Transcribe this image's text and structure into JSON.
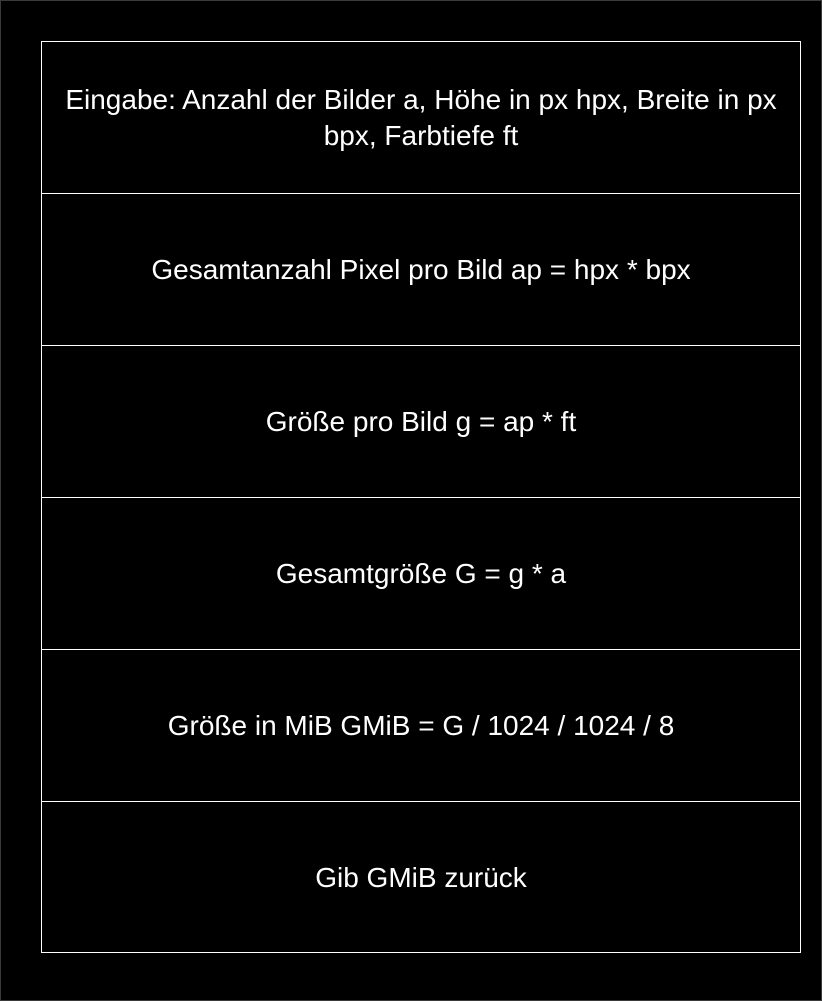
{
  "diagram": {
    "steps": [
      {
        "text": "Eingabe: Anzahl der Bilder a, Höhe in px hpx, Breite in px bpx, Farbtiefe ft"
      },
      {
        "text": "Gesamtanzahl Pixel pro Bild ap = hpx * bpx"
      },
      {
        "text": "Größe pro Bild g = ap * ft"
      },
      {
        "text": "Gesamtgröße G = g * a"
      },
      {
        "text": "Größe in MiB GMiB = G / 1024 / 1024 / 8"
      },
      {
        "text": "Gib GMiB zurück"
      }
    ]
  }
}
